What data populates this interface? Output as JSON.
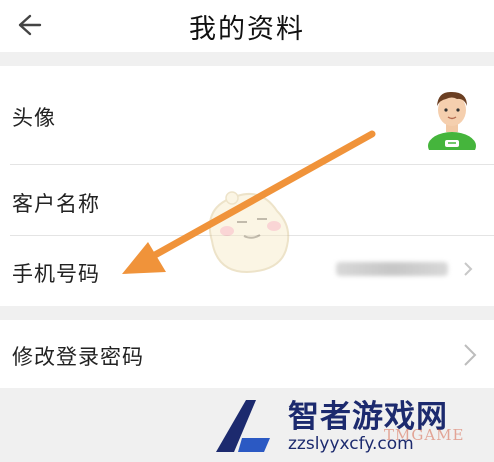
{
  "header": {
    "title": "我的资料"
  },
  "profile": {
    "avatar_label": "头像",
    "client_name_label": "客户名称",
    "phone_label": "手机号码",
    "password_label": "修改登录密码"
  },
  "watermark": {
    "brand": "智者游戏网",
    "url": "zzslyyxcfy.com",
    "sub": "TMGAME"
  },
  "colors": {
    "arrow": "#f0933a",
    "avatar_shirt": "#45b53c",
    "watermark_text": "#1c2a6e"
  }
}
